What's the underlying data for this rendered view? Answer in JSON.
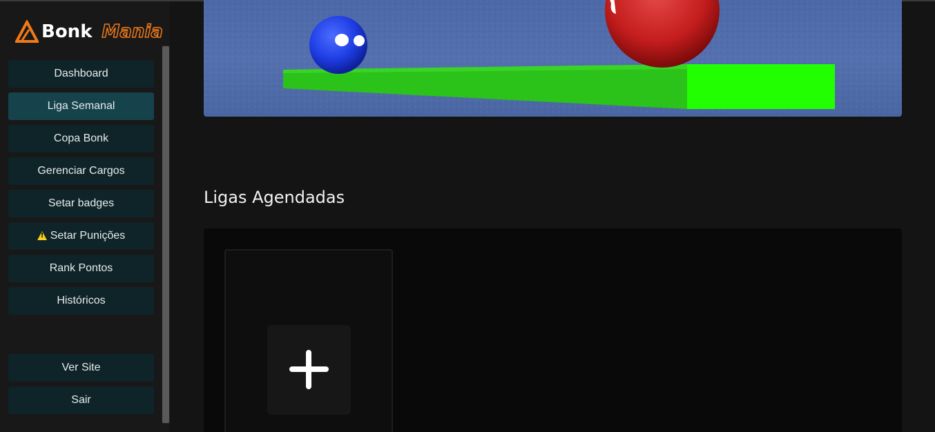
{
  "logo": {
    "word1": "Bonk",
    "word2": "Mania",
    "accent": "#f07a1a"
  },
  "sidebar": {
    "items": [
      {
        "label": "Dashboard",
        "active": false
      },
      {
        "label": "Liga Semanal",
        "active": true
      },
      {
        "label": "Copa Bonk",
        "active": false
      },
      {
        "label": "Gerenciar Cargos",
        "active": false
      },
      {
        "label": "Setar badges",
        "active": false
      },
      {
        "label": "Setar Punições",
        "active": false,
        "icon": "warning-icon"
      },
      {
        "label": "Rank Pontos",
        "active": false
      },
      {
        "label": "Históricos",
        "active": false
      }
    ],
    "footer_items": [
      {
        "label": "Ver Site"
      },
      {
        "label": "Sair"
      }
    ],
    "button_color": "#0f2428",
    "active_color": "#15424b"
  },
  "main": {
    "section_title": "Ligas Agendadas",
    "add_card_icon": "plus-icon"
  }
}
